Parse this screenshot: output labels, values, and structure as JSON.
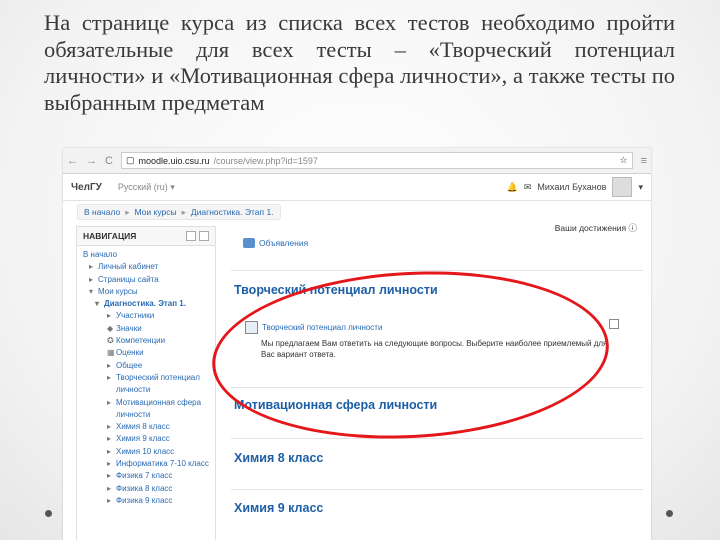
{
  "slide": {
    "text": "На странице курса из списка всех тестов необходимо пройти обязательные для всех тесты – «Творческий потенциал личности» и «Мотивационная сфера личности», а также тесты по выбранным предметам"
  },
  "browser": {
    "back": "←",
    "forward": "→",
    "reload": "C",
    "url_host": "moodle.uio.csu.ru",
    "url_path": "/course/view.php?id=1597",
    "star": "☆",
    "menu": "≡"
  },
  "topbar": {
    "brand": "ЧелГУ",
    "language": "Русский (ru) ▾",
    "user_name": "Михаил Буханов",
    "user_menu": "▾"
  },
  "breadcrumb": [
    "В начало",
    "Мои курсы",
    "Диагностика. Этап 1."
  ],
  "breadcrumb_sep": "▸",
  "navigation": {
    "title": "НАВИГАЦИЯ",
    "items": [
      {
        "label": "В начало",
        "level": 0
      },
      {
        "label": "Личный кабинет",
        "level": 1
      },
      {
        "label": "Страницы сайта",
        "level": 1
      },
      {
        "label": "Мои курсы",
        "level": 1
      },
      {
        "label": "Диагностика. Этап 1.",
        "level": 2
      },
      {
        "label": "Участники",
        "level": 3
      },
      {
        "label": "Значки",
        "level": 3
      },
      {
        "label": "Компетенции",
        "level": 3
      },
      {
        "label": "Оценки",
        "level": 3
      },
      {
        "label": "Общее",
        "level": 3
      },
      {
        "label": "Творческий потенциал личности",
        "level": 3
      },
      {
        "label": "Мотивационная сфера личности",
        "level": 3
      },
      {
        "label": "Химия 8 класс",
        "level": 3
      },
      {
        "label": "Химия 9 класс",
        "level": 3
      },
      {
        "label": "Химия 10 класс",
        "level": 3
      },
      {
        "label": "Информатика 7-10 класс",
        "level": 3
      },
      {
        "label": "Физика 7 класс",
        "level": 3
      },
      {
        "label": "Физика 8 класс",
        "level": 3
      },
      {
        "label": "Физика 9 класс",
        "level": 3
      }
    ]
  },
  "main": {
    "achievements": "Ваши достижения ⓘ",
    "news": "Объявления",
    "sections": [
      {
        "title": "Творческий потенциал личности",
        "quiz": "Творческий потенциал личности",
        "description": "Мы предлагаем Вам ответить на следующие вопросы. Выберите наиболее приемлемый для Вас вариант ответа."
      },
      {
        "title": "Мотивационная сфера личности"
      },
      {
        "title": "Химия 8 класс"
      },
      {
        "title": "Химия 9 класс"
      }
    ]
  },
  "colors": {
    "link": "#2a6bb3",
    "section_title": "#1d5fa6",
    "highlight_oval": "#e5171b"
  }
}
